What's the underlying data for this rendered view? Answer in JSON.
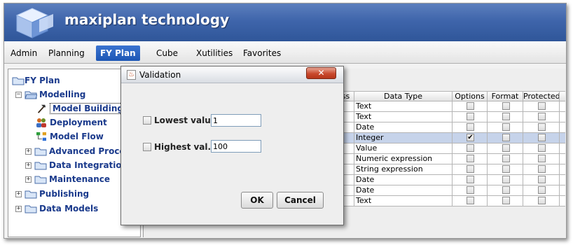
{
  "app": {
    "brand": "maxiplan technology",
    "colors": {
      "banner": "#3f65ab",
      "active_menu": "#1c56b5",
      "tree_text": "#1a3a8c",
      "selected_row": "#c6d3ea"
    }
  },
  "menu": [
    {
      "label": "Admin",
      "active": false
    },
    {
      "label": "Planning",
      "active": false
    },
    {
      "label": "FY Plan",
      "active": true
    },
    {
      "label": "Cube",
      "active": false
    },
    {
      "label": "Xutilities",
      "active": false
    },
    {
      "label": "Favorites",
      "active": false
    }
  ],
  "tree": {
    "root": {
      "label": "FY Plan",
      "icon": "folder-icon"
    },
    "modelling": {
      "label": "Modelling",
      "expander": "−",
      "icon": "folder-icon"
    },
    "model_building": {
      "label": "Model Building",
      "icon": "hammer-icon",
      "selected": true
    },
    "deployment": {
      "label": "Deployment",
      "icon": "users-icon"
    },
    "model_flow": {
      "label": "Model Flow",
      "icon": "flow-icon"
    },
    "advanced_process": {
      "label": "Advanced Process",
      "expander": "+",
      "icon": "folder-icon"
    },
    "data_integration": {
      "label": "Data Integration",
      "expander": "+",
      "icon": "folder-icon"
    },
    "maintenance": {
      "label": "Maintenance",
      "expander": "+",
      "icon": "folder-icon"
    },
    "publishing": {
      "label": "Publishing",
      "expander": "+",
      "icon": "folder-icon"
    },
    "data_models": {
      "label": "Data Models",
      "expander": "+",
      "icon": "folder-icon"
    }
  },
  "grid": {
    "headers": [
      "ss",
      "Data Type",
      "Options",
      "Format",
      "Protected"
    ],
    "rows": [
      {
        "type": "Text",
        "options": false
      },
      {
        "type": "Text",
        "options": false
      },
      {
        "type": "Date",
        "options": false
      },
      {
        "type": "Integer",
        "options": true,
        "selected": true
      },
      {
        "type": "Value",
        "options": false
      },
      {
        "type": "Numeric expression",
        "options": false
      },
      {
        "type": "String expression",
        "options": false
      },
      {
        "type": "Date",
        "options": false
      },
      {
        "type": "Date",
        "options": false
      },
      {
        "type": "Text",
        "options": false
      }
    ],
    "check_mark": "✔"
  },
  "dialog": {
    "title": "Validation",
    "close_symbol": "✕",
    "icon": "java-icon",
    "lowest_label": "Lowest value",
    "lowest_value": "1",
    "highest_label": "Highest val...",
    "highest_value": "100",
    "ok_label": "OK",
    "cancel_label": "Cancel"
  }
}
